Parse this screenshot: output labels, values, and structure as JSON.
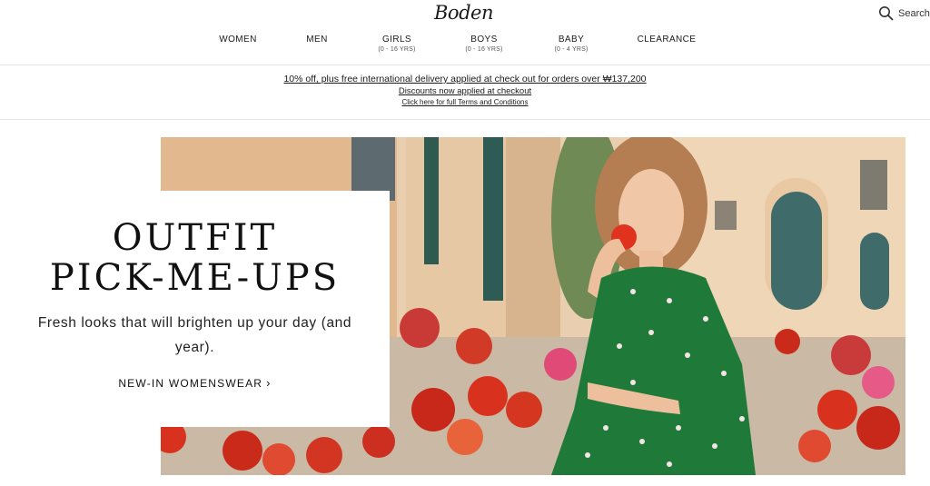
{
  "header": {
    "logo": "Boden",
    "search_label": "Search"
  },
  "nav": {
    "items": [
      {
        "label": "WOMEN",
        "sub": ""
      },
      {
        "label": "MEN",
        "sub": ""
      },
      {
        "label": "GIRLS",
        "sub": "(0 - 16 YRS)"
      },
      {
        "label": "BOYS",
        "sub": "(0 - 16 YRS)"
      },
      {
        "label": "BABY",
        "sub": "(0 - 4 YRS)"
      },
      {
        "label": "CLEARANCE",
        "sub": ""
      }
    ]
  },
  "promo": {
    "main": "10% off, plus free international delivery applied at check out for orders over ₩137,200",
    "sub": "Discounts now applied at checkout",
    "terms": "Click here for full Terms and Conditions"
  },
  "hero": {
    "headline_line1": "OUTFIT",
    "headline_line2": "PICK-ME-UPS",
    "subline": "Fresh looks that will brighten up your day (and year).",
    "cta_label": "NEW-IN WOMENSWEAR",
    "cta_chevron": "›"
  },
  "colors": {
    "dress_green": "#1f7a3a",
    "flower_red": "#d8321e",
    "wall_peach": "#e8c29c",
    "shutter_teal": "#3f6b6a"
  }
}
